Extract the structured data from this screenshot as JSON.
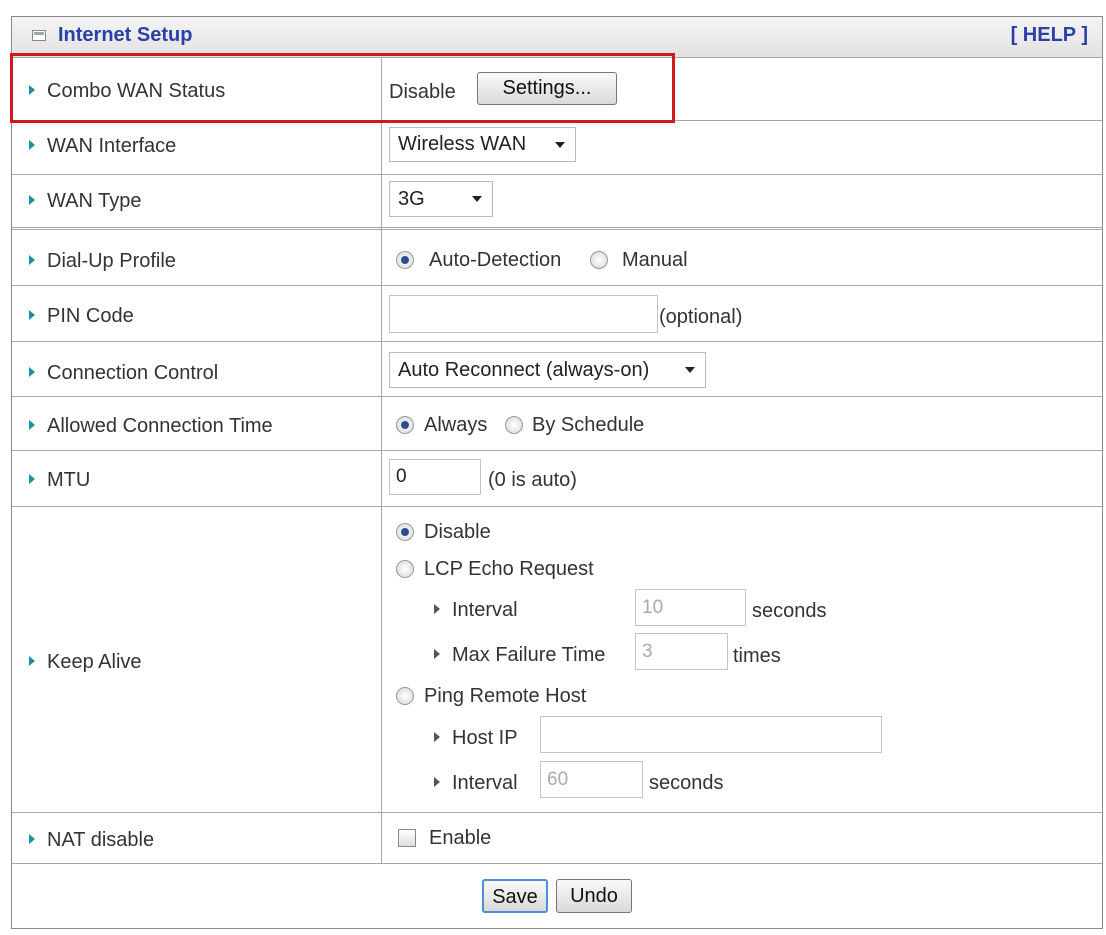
{
  "header": {
    "title": "Internet Setup",
    "help_label": "[ HELP ]",
    "icon": "window-icon"
  },
  "rows": {
    "combo_wan": {
      "label": "Combo WAN Status",
      "status": "Disable",
      "settings_button": "Settings..."
    },
    "wan_interface": {
      "label": "WAN Interface",
      "selected": "Wireless WAN"
    },
    "wan_type": {
      "label": "WAN Type",
      "selected": "3G"
    },
    "dial_up": {
      "label": "Dial-Up Profile",
      "options": [
        "Auto-Detection",
        "Manual"
      ],
      "selected": "Auto-Detection"
    },
    "pin_code": {
      "label": "PIN Code",
      "value": "",
      "hint": "(optional)"
    },
    "connection_control": {
      "label": "Connection Control",
      "selected": "Auto Reconnect (always-on)"
    },
    "allowed_time": {
      "label": "Allowed Connection Time",
      "options": [
        "Always",
        "By Schedule"
      ],
      "selected": "Always"
    },
    "mtu": {
      "label": "MTU",
      "value": "0",
      "hint": "(0 is auto)"
    },
    "keep_alive": {
      "label": "Keep Alive",
      "options": [
        "Disable",
        "LCP Echo Request",
        "Ping Remote Host"
      ],
      "selected": "Disable",
      "lcp_interval_label": "Interval",
      "lcp_interval_value": "10",
      "lcp_interval_unit": "seconds",
      "max_failure_label": "Max Failure Time",
      "max_failure_value": "3",
      "max_failure_unit": "times",
      "host_ip_label": "Host IP",
      "host_ip_value": "",
      "ping_interval_label": "Interval",
      "ping_interval_value": "60",
      "ping_interval_unit": "seconds"
    },
    "nat": {
      "label": "NAT disable",
      "checkbox_label": "Enable",
      "checked": false
    }
  },
  "footer": {
    "save_label": "Save",
    "undo_label": "Undo"
  },
  "colors": {
    "title": "#2a3fa8",
    "arrow": "#1e8ea0",
    "highlight": "#d4171c"
  }
}
